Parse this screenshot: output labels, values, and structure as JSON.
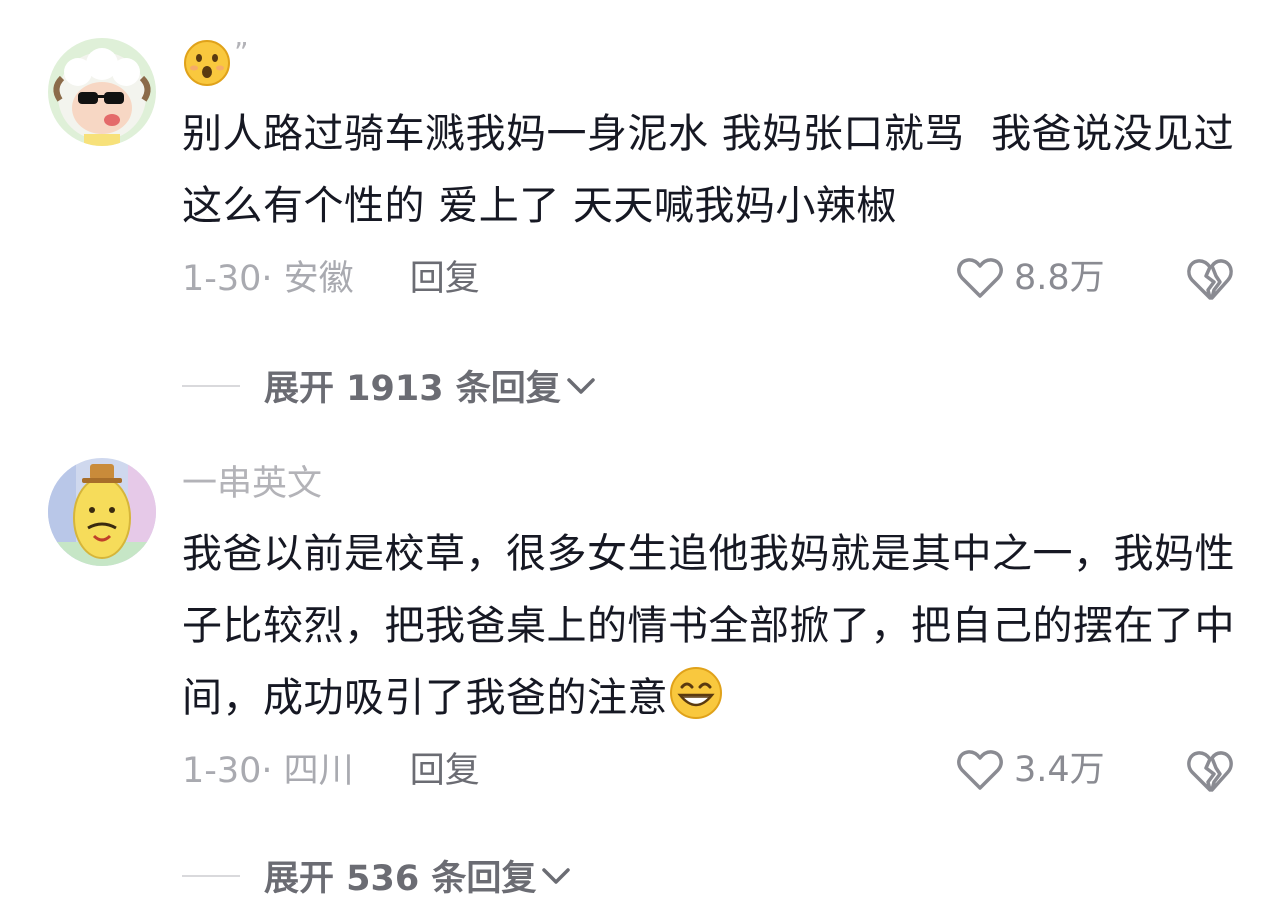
{
  "comments": [
    {
      "username": "",
      "text": "别人路过骑车溅我妈一身泥水 我妈张口就骂  我爸说没见过这么有个性的 爱上了 天天喊我妈小辣椒",
      "date_location": "1-30· 安徽",
      "reply_label": "回复",
      "likes": "8.8万",
      "expand_label": "展开 1913 条回复"
    },
    {
      "username": "一串英文",
      "text": "我爸以前是校草，很多女生追他我妈就是其中之一，我妈性子比较烈，把我爸桌上的情书全部掀了，把自己的摆在了中间，成功吸引了我爸的注意",
      "date_location": "1-30· 四川",
      "reply_label": "回复",
      "likes": "3.4万",
      "expand_label": "展开 536 条回复"
    }
  ],
  "quote_mark": "”",
  "icons": {
    "like": "heart-outline-icon",
    "dislike": "broken-heart-icon",
    "expand": "chevron-down-icon",
    "surprised_emoji": "surprised-face-emoji",
    "grin_emoji": "grinning-face-emoji"
  },
  "colors": {
    "text": "#161823",
    "meta": "#a9aab0",
    "reply": "#6b6c73",
    "background": "#ffffff"
  }
}
